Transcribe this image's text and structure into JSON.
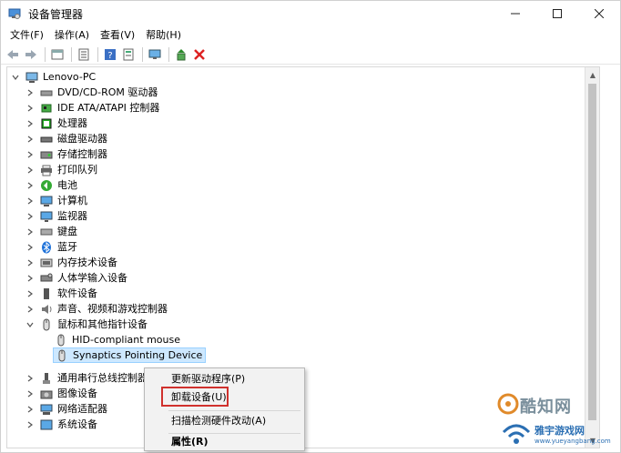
{
  "window": {
    "title": "设备管理器",
    "controls": {
      "minimize": "minimize-icon",
      "maximize": "maximize-icon",
      "close": "close-icon"
    }
  },
  "menu": [
    "文件(F)",
    "操作(A)",
    "查看(V)",
    "帮助(H)"
  ],
  "toolbar": [
    "back-icon",
    "forward-icon",
    "properties-pane-icon",
    "list-icon",
    "help-icon",
    "details-icon",
    "monitor-icon",
    "update-driver-icon",
    "uninstall-icon"
  ],
  "tree": {
    "root": "Lenovo-PC",
    "items": [
      {
        "label": "DVD/CD-ROM 驱动器",
        "icon": "dvd-drive-icon"
      },
      {
        "label": "IDE ATA/ATAPI 控制器",
        "icon": "ide-controller-icon"
      },
      {
        "label": "处理器",
        "icon": "processor-icon"
      },
      {
        "label": "磁盘驱动器",
        "icon": "disk-drive-icon"
      },
      {
        "label": "存储控制器",
        "icon": "storage-controller-icon"
      },
      {
        "label": "打印队列",
        "icon": "printer-icon"
      },
      {
        "label": "电池",
        "icon": "battery-icon"
      },
      {
        "label": "计算机",
        "icon": "computer-icon"
      },
      {
        "label": "监视器",
        "icon": "monitor-icon"
      },
      {
        "label": "键盘",
        "icon": "keyboard-icon"
      },
      {
        "label": "蓝牙",
        "icon": "bluetooth-icon"
      },
      {
        "label": "内存技术设备",
        "icon": "memory-icon"
      },
      {
        "label": "人体学输入设备",
        "icon": "hid-icon"
      },
      {
        "label": "软件设备",
        "icon": "software-device-icon"
      },
      {
        "label": "声音、视频和游戏控制器",
        "icon": "sound-icon"
      },
      {
        "label": "鼠标和其他指针设备",
        "icon": "mouse-icon"
      }
    ],
    "mouse_children": [
      {
        "label": "HID-compliant mouse",
        "icon": "mouse-icon"
      },
      {
        "label": "Synaptics Pointing Device",
        "icon": "mouse-icon"
      }
    ],
    "after_items": [
      {
        "label": "通用串行总线控制器",
        "icon": "usb-icon"
      },
      {
        "label": "图像设备",
        "icon": "camera-icon"
      },
      {
        "label": "网络适配器",
        "icon": "network-icon"
      },
      {
        "label": "系统设备",
        "icon": "system-device-icon"
      }
    ]
  },
  "context_menu": {
    "update": "更新驱动程序(P)",
    "uninstall": "卸载设备(U)",
    "scan": "扫描检测硬件改动(A)",
    "properties": "属性(R)"
  },
  "watermark": {
    "brand": "酷知网",
    "site": "雅宇游戏网",
    "url": "www.yueyangbang.com"
  },
  "colors": {
    "selection": "#cde8ff",
    "highlight_box": "#d0312d"
  }
}
